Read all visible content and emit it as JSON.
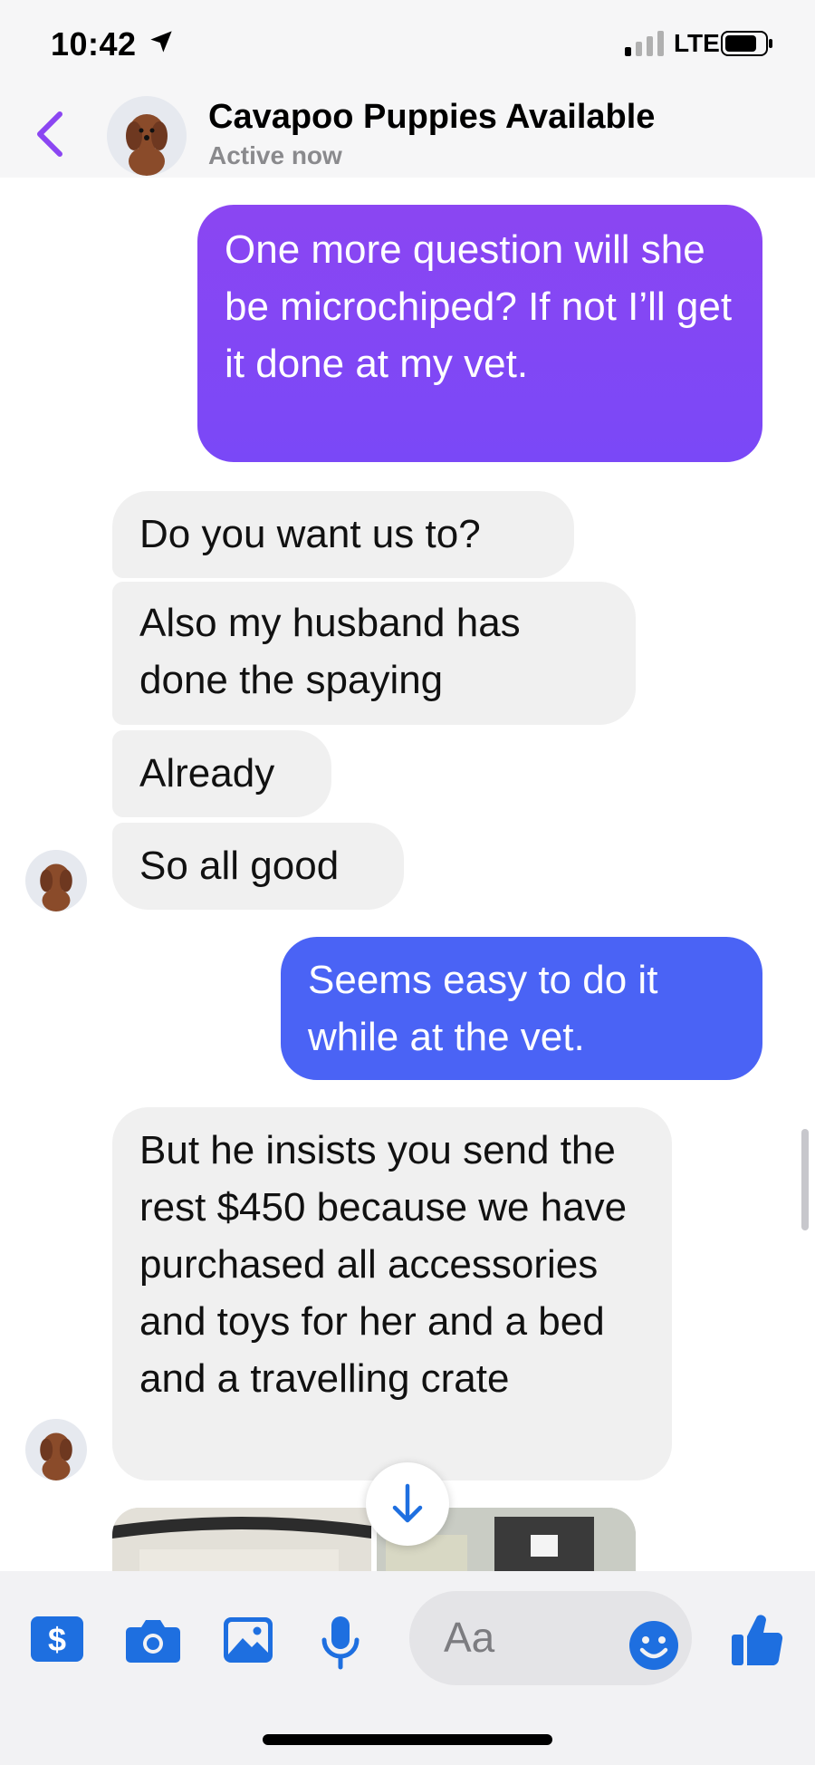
{
  "status_bar": {
    "time": "10:42",
    "network": "LTE"
  },
  "header": {
    "contact_name": "Cavapoo Puppies Available",
    "status": "Active now"
  },
  "messages": [
    {
      "from": "me",
      "text": "One more question will she be microchiped? If not I’ll get it done at my vet."
    },
    {
      "from": "them",
      "text": "Do you want us to?"
    },
    {
      "from": "them",
      "text": "Also my husband has done the spaying"
    },
    {
      "from": "them",
      "text": "Already"
    },
    {
      "from": "them",
      "text": "So all good"
    },
    {
      "from": "me",
      "text": "Seems easy to do it while at the vet."
    },
    {
      "from": "them",
      "text": "But he insists you send the rest $450 because we have purchased all accessories and toys for her and a bed and a travelling crate"
    }
  ],
  "composer": {
    "placeholder": "Aa"
  },
  "colors": {
    "accent": "#8b46f2",
    "sent_bubble_1": "#7f47f4",
    "sent_bubble_2": "#4a63f5",
    "received_bubble": "#f0f0f0",
    "toolbar_icon": "#1e6fe0"
  }
}
